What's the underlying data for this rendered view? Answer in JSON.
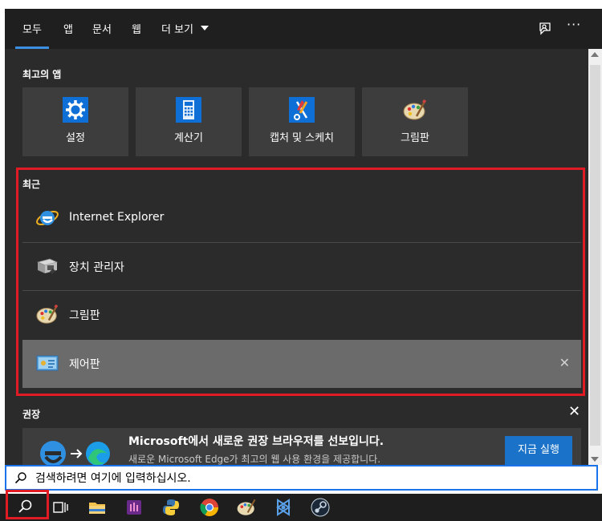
{
  "tabs": [
    {
      "label": "모두",
      "active": true
    },
    {
      "label": "앱"
    },
    {
      "label": "문서"
    },
    {
      "label": "웹"
    },
    {
      "label": "더 보기"
    }
  ],
  "top_apps": {
    "title": "최고의 앱",
    "items": [
      {
        "label": "설정",
        "icon": "settings-gear-icon"
      },
      {
        "label": "계산기",
        "icon": "calculator-icon"
      },
      {
        "label": "캡처 및 스케치",
        "icon": "snip-sketch-icon"
      },
      {
        "label": "그림판",
        "icon": "paint-palette-icon"
      }
    ]
  },
  "recent": {
    "title": "최근",
    "items": [
      {
        "label": "Internet Explorer",
        "icon": "internet-explorer-icon"
      },
      {
        "label": "장치 관리자",
        "icon": "device-manager-icon"
      },
      {
        "label": "그림판",
        "icon": "paint-palette-icon"
      },
      {
        "label": "제어판",
        "icon": "control-panel-icon",
        "selected": true
      }
    ]
  },
  "recommended": {
    "title": "권장",
    "headline": "Microsoft에서 새로운 권장 브라우저를 선보입니다.",
    "subtext": "새로운 Microsoft Edge가 최고의 웹 사용 환경을 제공합니다.",
    "button": "지금 실행"
  },
  "search": {
    "placeholder": "검색하려면 여기에 입력하십시오."
  },
  "colors": {
    "accent": "#3c8ee0",
    "highlight_border": "#e01b24",
    "button_blue": "#1a73c8"
  },
  "taskbar_icons": [
    "search-icon",
    "task-view-icon",
    "file-explorer-icon",
    "app-icon",
    "python-icon",
    "chrome-icon",
    "paint-icon",
    "visual-studio-icon",
    "steam-icon"
  ]
}
